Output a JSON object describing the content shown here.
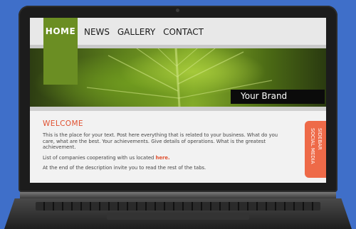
{
  "nav": {
    "items": [
      {
        "label": "HOME"
      },
      {
        "label": "NEWS"
      },
      {
        "label": "GALLERY"
      },
      {
        "label": "CONTACT"
      }
    ]
  },
  "banner": {
    "brand": "Your Brand"
  },
  "content": {
    "welcome": "WELCOME",
    "para1": "This is the place for your text. Post here everything that is related to your business. What do you care, what are the best. Your achievements. Give details of operations. What is the greatest achievement.",
    "para2_text": "List of companies cooperating with us located ",
    "para2_link": "here.",
    "para3": "At the end of the description invite you to read the rest of the tabs."
  },
  "sidebar": {
    "line1": "SIDEBAR",
    "line2": "SOCIAL MEDIA"
  },
  "colors": {
    "accent": "#6b8e23",
    "highlight": "#e0502f",
    "sidebar_tab": "#ee6a48",
    "background": "#3f6fc9"
  }
}
